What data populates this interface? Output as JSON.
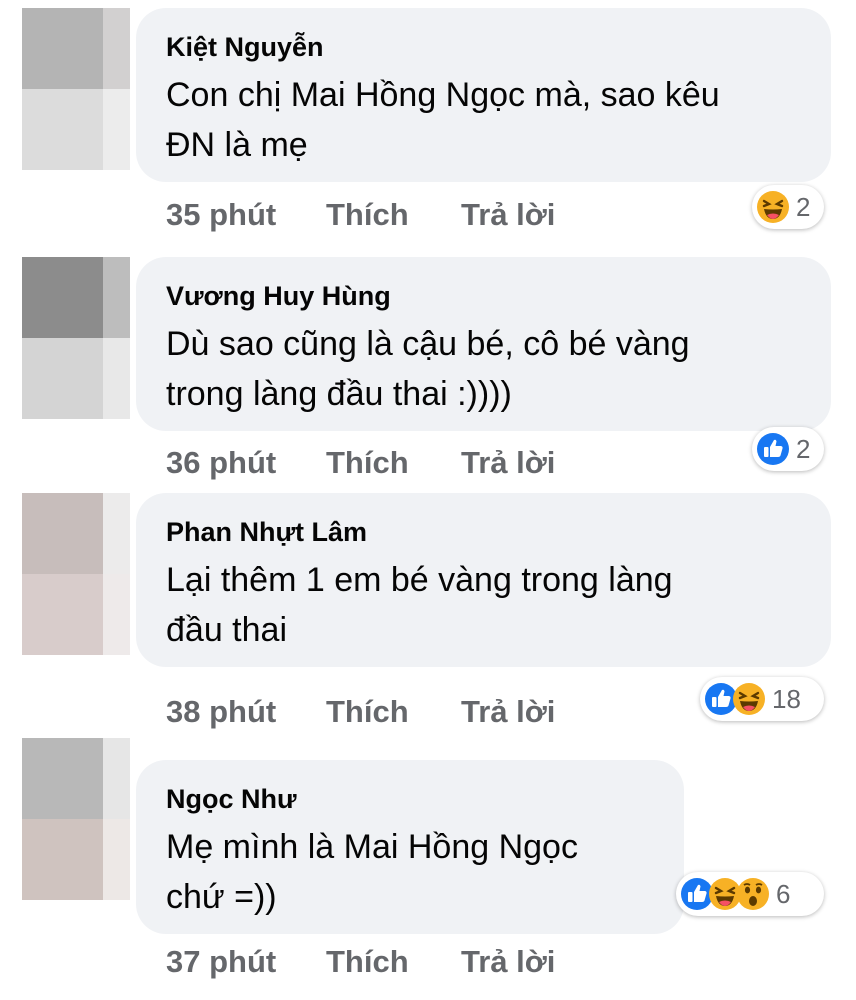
{
  "actions": {
    "like": "Thích",
    "reply": "Trả lời"
  },
  "comments": [
    {
      "author": "Kiệt Nguyễn",
      "text": "Con chị Mai Hồng Ngọc mà, sao kêu\nĐN là mẹ",
      "time": "35 phút",
      "reactions": [
        "haha-icon"
      ],
      "reaction_count": "2",
      "avatar_colors": [
        "#b4b4b4",
        "#d2d0d0",
        "#dcdcdc",
        "#ececec"
      ]
    },
    {
      "author": "Vương Huy Hùng",
      "text": "Dù sao cũng là cậu bé, cô bé vàng\ntrong làng đầu thai :))))",
      "time": "36 phút",
      "reactions": [
        "like-icon"
      ],
      "reaction_count": "2",
      "avatar_colors": [
        "#8c8c8c",
        "#bdbdbd",
        "#d4d4d4",
        "#e8e8e8"
      ]
    },
    {
      "author": "Phan Nhựt Lâm",
      "text": "Lại thêm 1 em bé vàng trong làng\nđầu thai",
      "time": "38 phút",
      "reactions": [
        "like-icon",
        "haha-icon"
      ],
      "reaction_count": "18",
      "avatar_colors": [
        "#c7bdbb",
        "#ecebeb",
        "#d8cccb",
        "#eeeaea"
      ]
    },
    {
      "author": "Ngọc Như",
      "text": "Mẹ mình là Mai Hồng Ngọc\nchứ =))",
      "time": "37 phút",
      "reactions": [
        "like-icon",
        "haha-icon",
        "wow-icon"
      ],
      "reaction_count": "6",
      "avatar_colors": [
        "#b8b8b8",
        "#e6e6e6",
        "#cfc3bf",
        "#ede8e6"
      ]
    }
  ],
  "colors": {
    "bubble": "#f0f2f5",
    "meta_text": "#65676b",
    "like_blue": "#1877f2",
    "emoji_yellow": "#f7b125"
  }
}
